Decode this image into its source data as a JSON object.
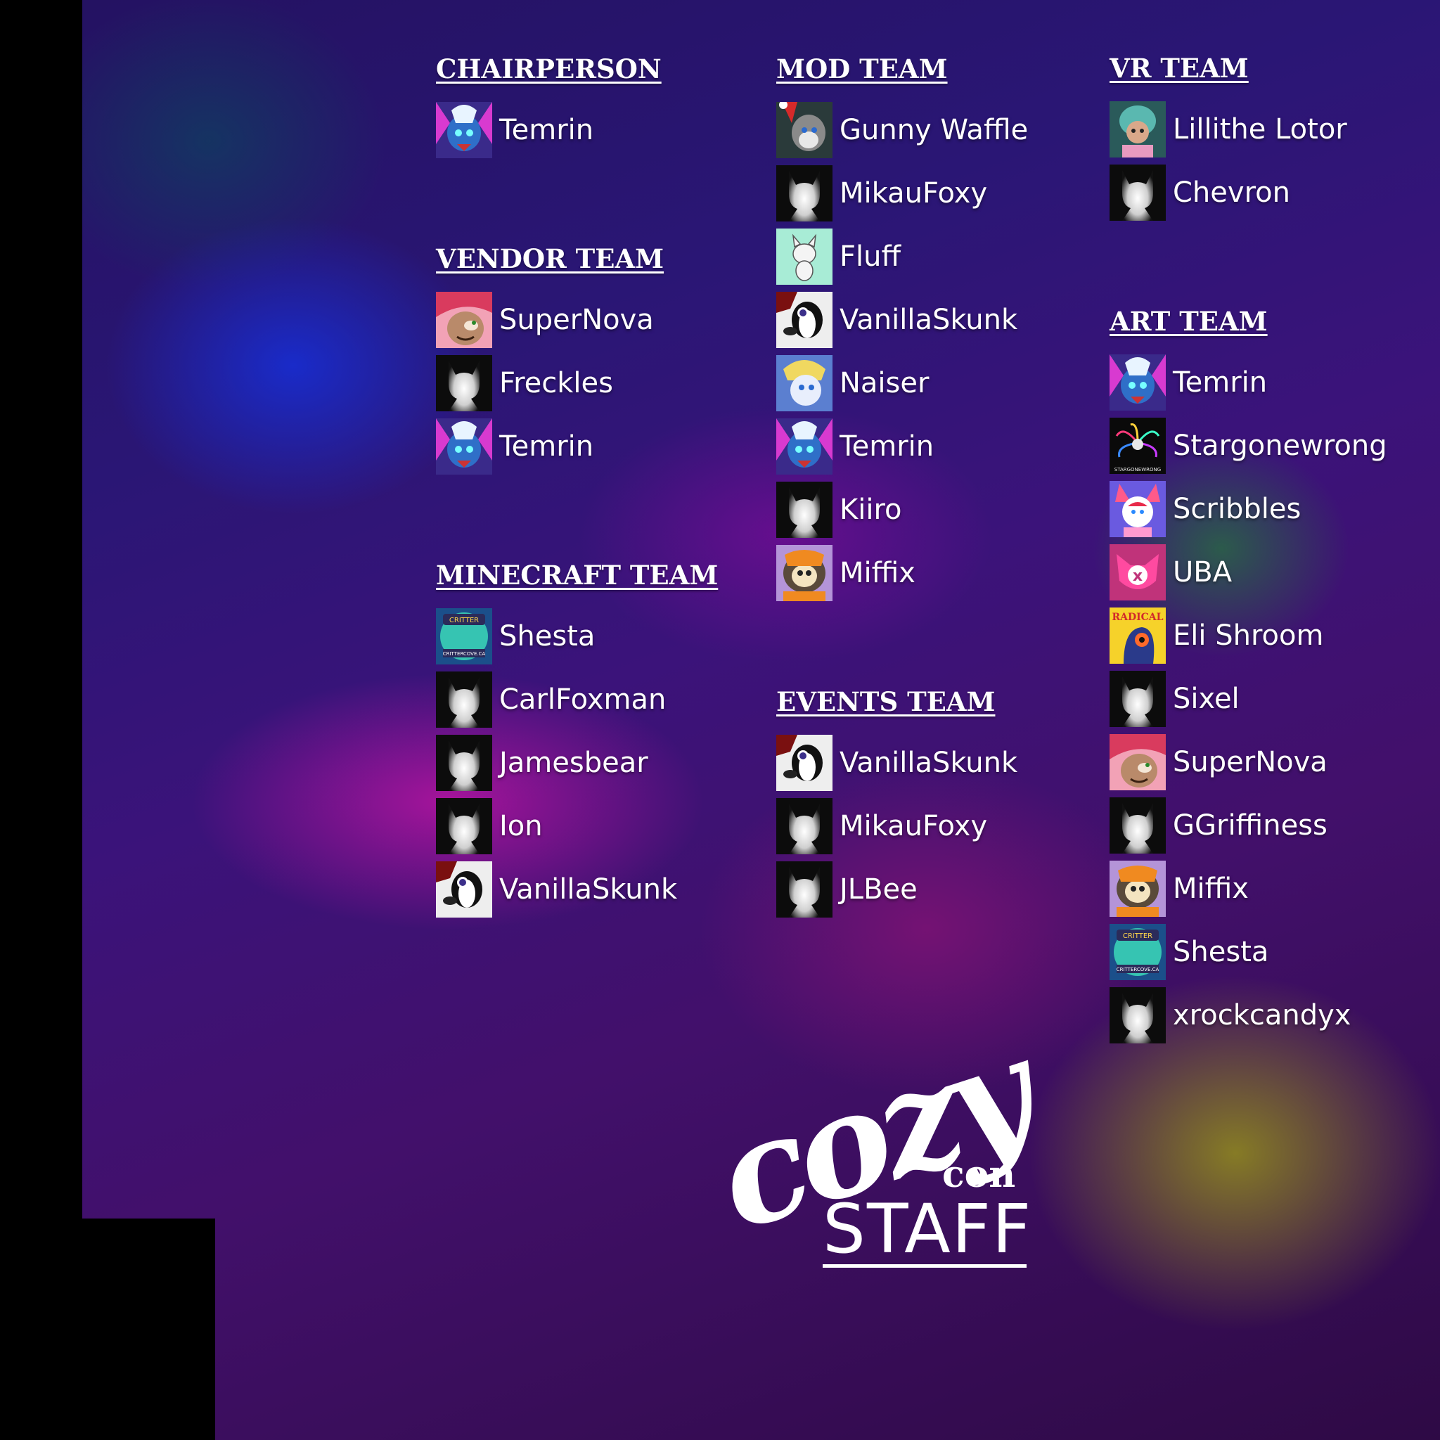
{
  "sections": {
    "chairperson": {
      "title": "CHAIRPERSON",
      "members": [
        {
          "name": "Temrin",
          "avatar": "temrin"
        }
      ]
    },
    "vendor": {
      "title": "VENDOR TEAM",
      "members": [
        {
          "name": "SuperNova",
          "avatar": "supernova"
        },
        {
          "name": "Freckles",
          "avatar": "placeholder"
        },
        {
          "name": "Temrin",
          "avatar": "temrin"
        }
      ]
    },
    "minecraft": {
      "title": "MINECRAFT TEAM",
      "members": [
        {
          "name": "Shesta",
          "avatar": "shesta"
        },
        {
          "name": "CarlFoxman",
          "avatar": "placeholder"
        },
        {
          "name": "Jamesbear",
          "avatar": "placeholder"
        },
        {
          "name": "Ion",
          "avatar": "placeholder"
        },
        {
          "name": "VanillaSkunk",
          "avatar": "vanillaskunk"
        }
      ]
    },
    "mod": {
      "title": "MOD TEAM",
      "members": [
        {
          "name": "Gunny Waffle",
          "avatar": "gunny"
        },
        {
          "name": "MikauFoxy",
          "avatar": "placeholder"
        },
        {
          "name": "Fluff",
          "avatar": "fluff"
        },
        {
          "name": "VanillaSkunk",
          "avatar": "vanillaskunk"
        },
        {
          "name": "Naiser",
          "avatar": "naiser"
        },
        {
          "name": "Temrin",
          "avatar": "temrin"
        },
        {
          "name": "Kiiro",
          "avatar": "placeholder"
        },
        {
          "name": "Miffix",
          "avatar": "miffix"
        }
      ]
    },
    "events": {
      "title": "EVENTS TEAM",
      "members": [
        {
          "name": "VanillaSkunk",
          "avatar": "vanillaskunk"
        },
        {
          "name": "MikauFoxy",
          "avatar": "placeholder"
        },
        {
          "name": "JLBee",
          "avatar": "placeholder"
        }
      ]
    },
    "vr": {
      "title": "VR TEAM",
      "members": [
        {
          "name": "Lillithe Lotor",
          "avatar": "lillithe"
        },
        {
          "name": "Chevron",
          "avatar": "placeholder"
        }
      ]
    },
    "art": {
      "title": "ART TEAM",
      "members": [
        {
          "name": "Temrin",
          "avatar": "temrin"
        },
        {
          "name": "Stargonewrong",
          "avatar": "stargonewrong"
        },
        {
          "name": "Scribbles",
          "avatar": "scribbles"
        },
        {
          "name": "UBA",
          "avatar": "uba"
        },
        {
          "name": "Eli Shroom",
          "avatar": "elishroom"
        },
        {
          "name": "Sixel",
          "avatar": "placeholder"
        },
        {
          "name": "SuperNova",
          "avatar": "supernova"
        },
        {
          "name": "GGriffiness",
          "avatar": "placeholder"
        },
        {
          "name": "Miffix",
          "avatar": "miffix"
        },
        {
          "name": "Shesta",
          "avatar": "shesta"
        },
        {
          "name": "xrockcandyx",
          "avatar": "placeholder"
        }
      ]
    }
  },
  "logo": {
    "cozy": "cozy",
    "con": "con",
    "staff": "STAFF"
  }
}
